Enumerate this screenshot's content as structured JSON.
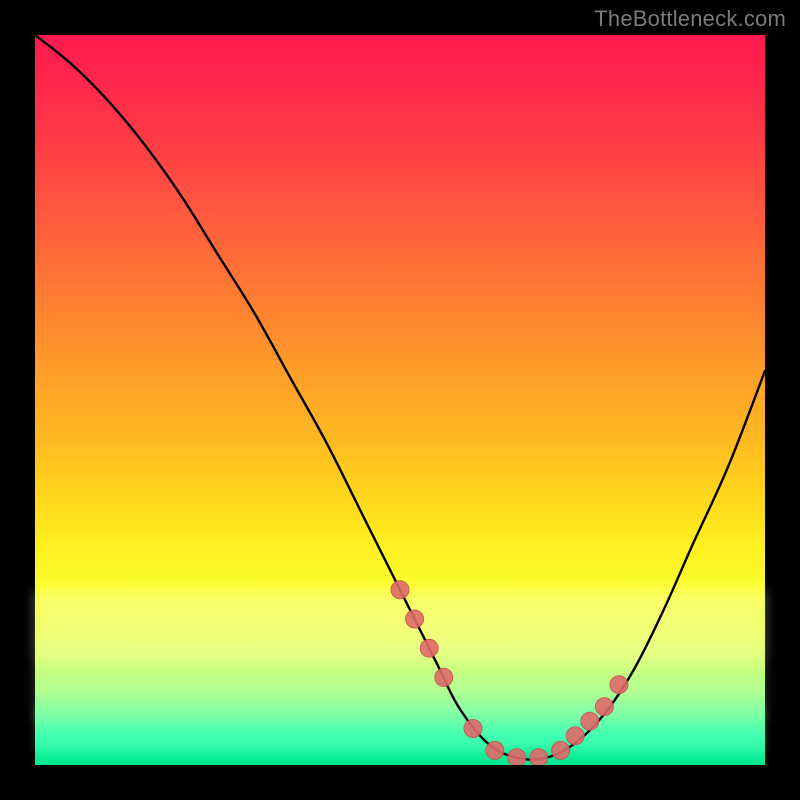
{
  "attribution": "TheBottleneck.com",
  "colors": {
    "page_bg": "#000000",
    "curve": "#000000",
    "marker_fill": "#e06a6a",
    "marker_stroke": "#c94f4f",
    "gradient_stops": [
      "#ff1a4f",
      "#ff2a4a",
      "#ff4045",
      "#ff5a3e",
      "#ff7a33",
      "#ff9a2a",
      "#ffb822",
      "#ffd61c",
      "#fff020",
      "#f8ff30",
      "#e8ff4a",
      "#d0ff68",
      "#a8ff88",
      "#70ffa0",
      "#30ffb0",
      "#00e890"
    ]
  },
  "chart_data": {
    "type": "line",
    "title": "",
    "xlabel": "",
    "ylabel": "",
    "xlim": [
      0,
      100
    ],
    "ylim": [
      0,
      100
    ],
    "grid": false,
    "legend": false,
    "series": [
      {
        "name": "bottleneck-curve",
        "x": [
          0,
          5,
          10,
          15,
          20,
          25,
          30,
          35,
          40,
          45,
          50,
          55,
          58,
          62,
          66,
          70,
          74,
          78,
          82,
          86,
          90,
          95,
          100
        ],
        "y": [
          100,
          96,
          91,
          85,
          78,
          70,
          62,
          53,
          44,
          34,
          24,
          14,
          8,
          3,
          1,
          1,
          3,
          7,
          13,
          21,
          30,
          41,
          54
        ]
      }
    ],
    "markers": {
      "name": "highlight-points",
      "x": [
        50,
        52,
        54,
        56,
        60,
        63,
        66,
        69,
        72,
        74,
        76,
        78,
        80
      ],
      "y": [
        24,
        20,
        16,
        12,
        5,
        2,
        1,
        1,
        2,
        4,
        6,
        8,
        11
      ]
    }
  }
}
